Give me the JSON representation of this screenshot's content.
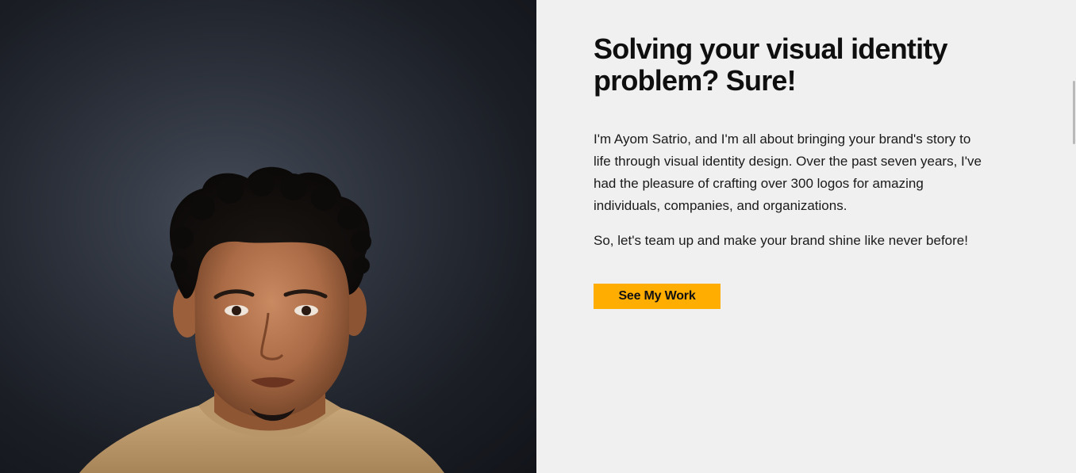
{
  "hero": {
    "image_alt": "Portrait of Ayom Satrio",
    "headline": "Solving your visual identity problem? Sure!",
    "bio": "I'm Ayom Satrio, and I'm all about bringing your brand's story to life through visual identity design. Over the past seven years, I've had the pleasure of crafting over 300 logos for amazing individuals, companies, and organizations.",
    "cta_text": "So, let's team up and make your brand shine like never before!",
    "button_label": "See My Work"
  },
  "colors": {
    "accent": "#ffad00",
    "background": "#f0f0f0",
    "text": "#0f0f0f",
    "photo_backdrop": "#1b1e25"
  }
}
